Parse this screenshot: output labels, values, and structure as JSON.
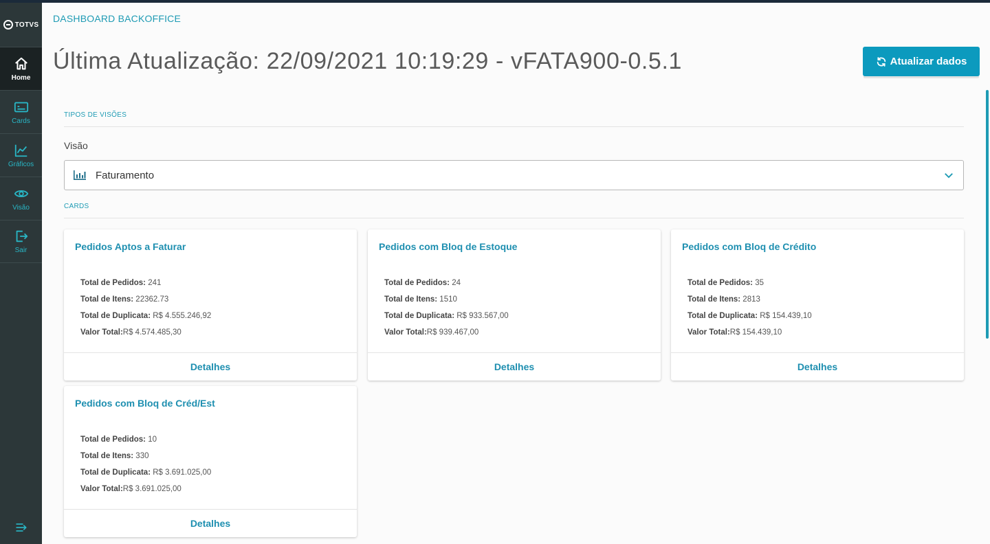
{
  "brand": {
    "logo_text": "TOTVS"
  },
  "sidebar": {
    "items": [
      {
        "label": "Home",
        "icon": "home-icon",
        "active": true
      },
      {
        "label": "Cards",
        "icon": "card-icon"
      },
      {
        "label": "Gráficos",
        "icon": "chart-icon"
      },
      {
        "label": "Visão",
        "icon": "eye-icon"
      },
      {
        "label": "Sair",
        "icon": "logout-icon"
      }
    ],
    "collapse_icon": "menu-collapse-icon"
  },
  "header": {
    "breadcrumb": "DASHBOARD BACKOFFICE",
    "title": "Última Atualização: 22/09/2021 10:19:29 - vFATA900-0.5.1",
    "refresh_button": "Atualizar dados"
  },
  "views_section": {
    "label": "TIPOS DE VISÕES",
    "field_label": "Visão",
    "selected": "Faturamento"
  },
  "cards_section": {
    "label": "CARDS",
    "details_label": "Detalhes",
    "cards": [
      {
        "title": "Pedidos Aptos a Faturar",
        "lines": [
          {
            "k": "Total de Pedidos:",
            "v": " 241"
          },
          {
            "k": "Total de Itens:",
            "v": " 22362.73"
          },
          {
            "k": "Total de Duplicata:",
            "v": " R$ 4.555.246,92"
          },
          {
            "k": "Valor Total:",
            "v": "R$ 4.574.485,30"
          }
        ]
      },
      {
        "title": "Pedidos com Bloq de Estoque",
        "lines": [
          {
            "k": "Total de Pedidos:",
            "v": " 24"
          },
          {
            "k": "Total de Itens:",
            "v": " 1510"
          },
          {
            "k": "Total de Duplicata:",
            "v": " R$ 933.567,00"
          },
          {
            "k": "Valor Total:",
            "v": "R$ 939.467,00"
          }
        ]
      },
      {
        "title": "Pedidos com Bloq de Crédito",
        "lines": [
          {
            "k": "Total de Pedidos:",
            "v": " 35"
          },
          {
            "k": "Total de Itens:",
            "v": " 2813"
          },
          {
            "k": "Total de Duplicata:",
            "v": " R$ 154.439,10"
          },
          {
            "k": "Valor Total:",
            "v": "R$ 154.439,10"
          }
        ]
      },
      {
        "title": "Pedidos com Bloq de Créd/Est",
        "lines": [
          {
            "k": "Total de Pedidos:",
            "v": " 10"
          },
          {
            "k": "Total de Itens:",
            "v": " 330"
          },
          {
            "k": "Total de Duplicata:",
            "v": " R$ 3.691.025,00"
          },
          {
            "k": "Valor Total:",
            "v": "R$ 3.691.025,00"
          }
        ]
      }
    ]
  }
}
